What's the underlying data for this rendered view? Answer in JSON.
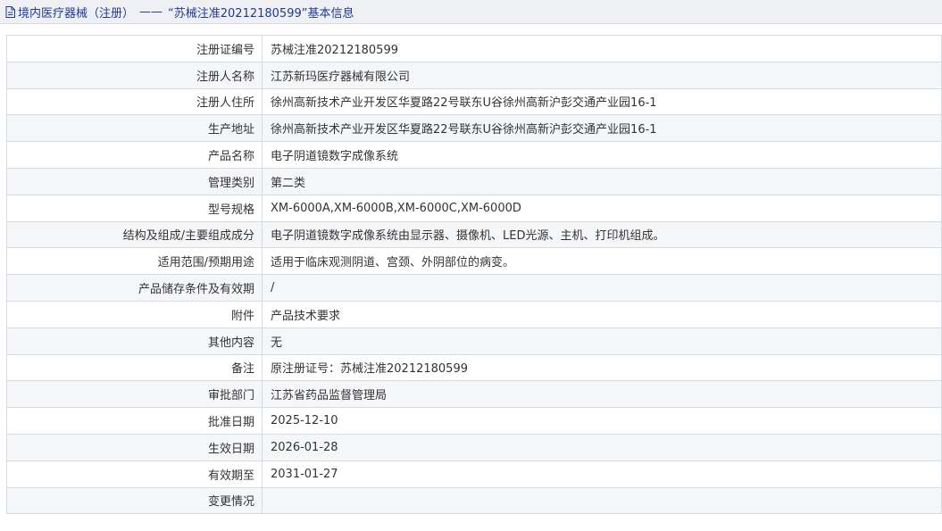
{
  "header": {
    "category": "境内医疗器械（注册）",
    "separator": "——",
    "record_title": "“苏械注准20212180599”基本信息"
  },
  "rows": [
    {
      "label": "注册证编号",
      "value": "苏械注准20212180599"
    },
    {
      "label": "注册人名称",
      "value": "江苏新玛医疗器械有限公司"
    },
    {
      "label": "注册人住所",
      "value": "徐州高新技术产业开发区华夏路22号联东U谷徐州高新沪彭交通产业园16-1"
    },
    {
      "label": "生产地址",
      "value": "徐州高新技术产业开发区华夏路22号联东U谷徐州高新沪彭交通产业园16-1"
    },
    {
      "label": "产品名称",
      "value": "电子阴道镜数字成像系统"
    },
    {
      "label": "管理类别",
      "value": "第二类"
    },
    {
      "label": "型号规格",
      "value": "XM-6000A,XM-6000B,XM-6000C,XM-6000D"
    },
    {
      "label": "结构及组成/主要组成成分",
      "value": "电子阴道镜数字成像系统由显示器、摄像机、LED光源、主机、打印机组成。"
    },
    {
      "label": "适用范围/预期用途",
      "value": "适用于临床观测阴道、宫颈、外阴部位的病变。"
    },
    {
      "label": "产品储存条件及有效期",
      "value": "/"
    },
    {
      "label": "附件",
      "value": "产品技术要求"
    },
    {
      "label": "其他内容",
      "value": "无"
    },
    {
      "label": "备注",
      "value": "原注册证号：苏械注准20212180599"
    },
    {
      "label": "审批部门",
      "value": "江苏省药品监督管理局"
    },
    {
      "label": "批准日期",
      "value": "2025-12-10"
    },
    {
      "label": "生效日期",
      "value": "2026-01-28"
    },
    {
      "label": "有效期至",
      "value": "2031-01-27"
    },
    {
      "label": "变更情况",
      "value": ""
    }
  ]
}
